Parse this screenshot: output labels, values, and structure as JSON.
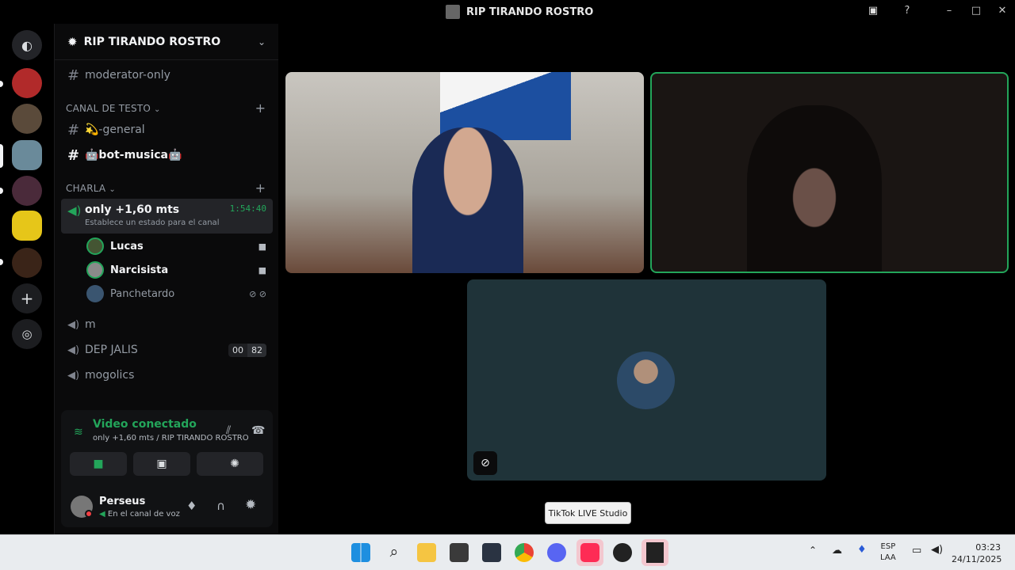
{
  "window": {
    "title": "RIP TIRANDO ROSTRO"
  },
  "server": {
    "name": "RIP TIRANDO ROSTRO"
  },
  "channels": {
    "moderator": "moderator-only",
    "cat1": "CANAL DE TESTO",
    "general": "💫-general",
    "bot": "🤖bot-musica🤖",
    "cat2": "CHARLA",
    "voice_active": "only +1,60 mts",
    "voice_timer": "1:54:40",
    "voice_status": "Establece un estado para el canal",
    "users": [
      "Lucas",
      "Narcisista",
      "Panchetardo"
    ],
    "m": "m",
    "dep": "DEP JALIS",
    "dep_count1": "00",
    "dep_count2": "82",
    "mogolics": "mogolics"
  },
  "voice_panel": {
    "status": "Video conectado",
    "channel": "only +1,60 mts / RIP TIRANDO ROSTRO"
  },
  "user": {
    "name": "Perseus",
    "status": "En el canal de voz"
  },
  "tooltip": "TikTok LIVE Studio",
  "tray": {
    "lang1": "ESP",
    "lang2": "LAA",
    "time": "03:23",
    "date": "24/11/2025"
  },
  "colors": {
    "green": "#23a55a",
    "blurple": "#5865f2",
    "bg": "#000000"
  }
}
